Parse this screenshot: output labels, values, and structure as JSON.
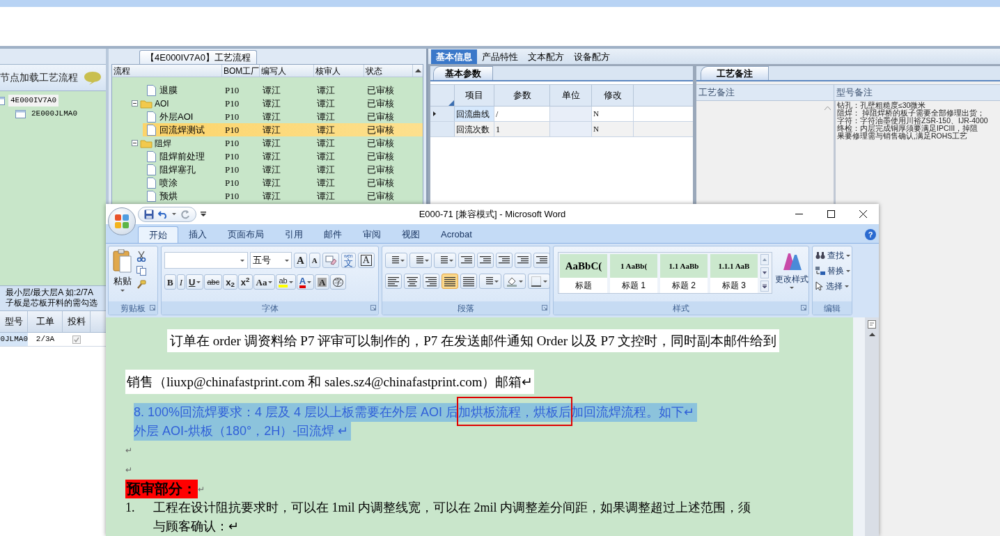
{
  "left_panel": {
    "header": "节点加载工艺流程",
    "tree": [
      {
        "label": "4E000IV7A0",
        "selected": true,
        "children": [
          {
            "label": "2E000JLMA0",
            "selected": false
          }
        ]
      }
    ],
    "hint": [
      "最小层/最大层A 如:2/7A",
      "子板是芯板开料的需勾选"
    ],
    "columns": [
      "型号",
      "工单",
      "投料"
    ],
    "rows": [
      {
        "model": "0JLMA0",
        "order": "2/3A",
        "checked": true
      }
    ]
  },
  "process": {
    "title": "【4E000IV7A0】工艺流程",
    "columns": [
      "流程",
      "BOM工厂",
      "编写人",
      "核审人",
      "状态"
    ],
    "rows": [
      {
        "kind": "item",
        "label": "退膜",
        "factory": "P10",
        "writer": "谭江",
        "reviewer": "谭江",
        "status": "已审核",
        "selected": false
      },
      {
        "kind": "folder",
        "label": "AOI",
        "factory": "P10",
        "writer": "谭江",
        "reviewer": "谭江",
        "status": "已审核",
        "selected": false,
        "expanded": true,
        "children": [
          {
            "kind": "item",
            "label": "外层AOI",
            "factory": "P10",
            "writer": "谭江",
            "reviewer": "谭江",
            "status": "已审核",
            "selected": false
          },
          {
            "kind": "item",
            "label": "回流焊测试",
            "factory": "P10",
            "writer": "谭江",
            "reviewer": "谭江",
            "status": "已审核",
            "selected": true
          }
        ]
      },
      {
        "kind": "folder",
        "label": "阻焊",
        "factory": "P10",
        "writer": "谭江",
        "reviewer": "谭江",
        "status": "已审核",
        "selected": false,
        "expanded": true,
        "children": [
          {
            "kind": "item",
            "label": "阻焊前处理",
            "factory": "P10",
            "writer": "谭江",
            "reviewer": "谭江",
            "status": "已审核",
            "selected": false
          },
          {
            "kind": "item",
            "label": "阻焊塞孔",
            "factory": "P10",
            "writer": "谭江",
            "reviewer": "谭江",
            "status": "已审核",
            "selected": false
          },
          {
            "kind": "item",
            "label": "喷涂",
            "factory": "P10",
            "writer": "谭江",
            "reviewer": "谭江",
            "status": "已审核",
            "selected": false
          },
          {
            "kind": "item",
            "label": "预烘",
            "factory": "P10",
            "writer": "谭江",
            "reviewer": "谭江",
            "status": "已审核",
            "selected": false
          }
        ]
      }
    ]
  },
  "info": {
    "tabs": [
      {
        "label": "基本信息",
        "selected": true
      },
      {
        "label": "产品特性",
        "selected": false
      },
      {
        "label": "文本配方",
        "selected": false
      },
      {
        "label": "设备配方",
        "selected": false
      }
    ],
    "params": {
      "tab": "基本参数",
      "columns": [
        "项目",
        "参数",
        "单位",
        "修改"
      ],
      "rows": [
        {
          "item": "回流曲线",
          "value": "/",
          "modified": "N",
          "current": true
        },
        {
          "item": "回流次数",
          "value": "1",
          "modified": "N",
          "current": false
        }
      ]
    },
    "notes": {
      "tab": "工艺备注",
      "columns": [
        "工艺备注",
        "型号备注"
      ],
      "model_note": [
        "钻孔：孔壁粗糙度≤30微米",
        "阻焊： 掉阻焊桥的板子需要全部修理出货；",
        "字符：字符油墨使用川裕ZSR-150、IJR-4000",
        "终检：内层完成铜厚须要满足IPCIII，掉阻",
        "果要修理需与销售确认,满足ROHS工艺"
      ]
    }
  },
  "word": {
    "title": "E000-71 [兼容模式] - Microsoft Word",
    "help": "?",
    "tabs": [
      {
        "label": "开始",
        "selected": true
      },
      {
        "label": "插入",
        "selected": false
      },
      {
        "label": "页面布局",
        "selected": false
      },
      {
        "label": "引用",
        "selected": false
      },
      {
        "label": "邮件",
        "selected": false
      },
      {
        "label": "审阅",
        "selected": false
      },
      {
        "label": "视图",
        "selected": false
      },
      {
        "label": "Acrobat",
        "selected": false
      }
    ],
    "clipboard": {
      "paste": "粘贴",
      "label": "剪贴板"
    },
    "font": {
      "size": "五号",
      "label": "字体",
      "row_1": [
        {
          "kind": "grow",
          "label": "A"
        },
        {
          "kind": "shrink",
          "label": "A"
        },
        {
          "kind": "clear"
        },
        {
          "kind": "phonetic",
          "ruby": "wén",
          "label": "文"
        },
        {
          "kind": "border",
          "label": "A"
        }
      ],
      "row_2": [
        {
          "kind": "bold",
          "label": "B"
        },
        {
          "kind": "italic",
          "label": "I"
        },
        {
          "kind": "underline",
          "label": "U",
          "menu": true
        },
        {
          "kind": "strike",
          "label": "abc"
        },
        {
          "kind": "script",
          "label": "x$_{2}$"
        },
        {
          "kind": "script",
          "label": "x$^{2}$"
        },
        {
          "kind": "case",
          "label": "Aa",
          "menu": true
        },
        {
          "kind": "highlight",
          "label": "ab",
          "menu": true
        },
        {
          "kind": "color",
          "label": "A",
          "menu": true
        },
        {
          "kind": "shade",
          "label": "A"
        },
        {
          "kind": "enclose",
          "label": "字"
        }
      ]
    },
    "paragraph": {
      "label": "段落",
      "align": [
        {
          "selected": false
        },
        {
          "selected": false
        },
        {
          "selected": false
        },
        {
          "selected": true
        },
        {
          "selected": false
        }
      ]
    },
    "styles": {
      "label": "样式",
      "change": "更改样式",
      "items": [
        {
          "sample": "AaBbC(",
          "label": "标题"
        },
        {
          "sample": "1  AaBb(",
          "label": "标题 1"
        },
        {
          "sample": "1.1  AaBb",
          "label": "标题 2"
        },
        {
          "sample": "1.1.1  AaB",
          "label": "标题 3"
        }
      ]
    },
    "editing": {
      "label": "编辑",
      "items": [
        {
          "kind": "find",
          "label": "查找"
        },
        {
          "kind": "replace",
          "label": "替换"
        },
        {
          "kind": "select",
          "label": "选择"
        }
      ]
    },
    "document": [
      {
        "kind": "centered",
        "text": "订单在 order 调资料给 P7 评审可以制作的，P7 在发送邮件通知 Order 以及 P7 文控时，同时副本邮件给到"
      },
      {
        "kind": "boxed",
        "text": "销售（liuxp@chinafastprint.com 和 sales.sz4@chinafastprint.com）邮箱↵"
      },
      {
        "kind": "selection",
        "lines": [
          "8. 100%回流焊要求：4 层及 4 层以上板需要在外层 AOI 后加烘板流程，烘板后加回流焊流程。如下↵",
          "外层 AOI-烘板（180°，2H）-回流焊 ↵"
        ]
      },
      {
        "kind": "mark",
        "text": "↵"
      },
      {
        "kind": "mark",
        "text": "↵"
      },
      {
        "kind": "heading",
        "text": "预审部分：",
        "mark": "↵"
      },
      {
        "kind": "numbered",
        "number": "1.",
        "lines": [
          "工程在设计阻抗要求时，可以在 1mil 内调整线宽，可以在 2mil 内调整差分间距，如果调整超过上述范围，须",
          "与顾客确认：↵"
        ]
      }
    ]
  }
}
